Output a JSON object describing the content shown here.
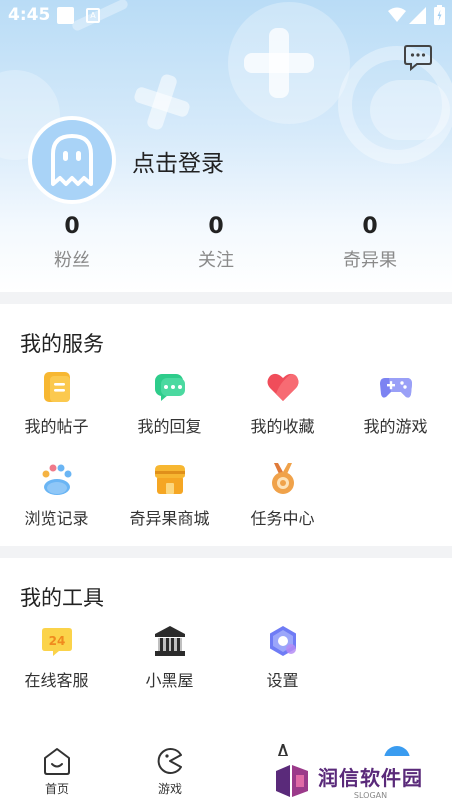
{
  "status_bar": {
    "time": "4:45",
    "notif_badge": "A"
  },
  "profile": {
    "login_label": "点击登录"
  },
  "stats": [
    {
      "value": "0",
      "label": "粉丝"
    },
    {
      "value": "0",
      "label": "关注"
    },
    {
      "value": "0",
      "label": "奇异果"
    }
  ],
  "services": {
    "title": "我的服务",
    "items": [
      {
        "label": "我的帖子",
        "icon": "document-icon"
      },
      {
        "label": "我的回复",
        "icon": "chat-bubble-icon"
      },
      {
        "label": "我的收藏",
        "icon": "heart-icon"
      },
      {
        "label": "我的游戏",
        "icon": "gamepad-icon"
      },
      {
        "label": "浏览记录",
        "icon": "paw-icon"
      },
      {
        "label": "奇异果商城",
        "icon": "shop-icon"
      },
      {
        "label": "任务中心",
        "icon": "medal-icon"
      }
    ]
  },
  "tools": {
    "title": "我的工具",
    "items": [
      {
        "label": "在线客服",
        "icon": "customer-service-icon",
        "badge": "24"
      },
      {
        "label": "小黑屋",
        "icon": "jail-icon"
      },
      {
        "label": "设置",
        "icon": "settings-icon"
      }
    ]
  },
  "bottom_nav": [
    {
      "label": "首页",
      "icon": "home-icon"
    },
    {
      "label": "游戏",
      "icon": "game-icon"
    }
  ],
  "watermark": {
    "title": "润信软件园",
    "slogan": "SLOGAN"
  },
  "colors": {
    "header_blue": "#b9dcf6",
    "doc_yellow": "#f7b731",
    "chat_green": "#2ecc8b",
    "heart_red": "#f04d5a",
    "pad_purple": "#7c83f2",
    "paw_blue": "#6ab5f4",
    "shop_orange": "#f5a623",
    "medal_orange": "#f0a24a",
    "settings_purple": "#6f7cf5",
    "watermark_purple": "#5a2a7a"
  }
}
